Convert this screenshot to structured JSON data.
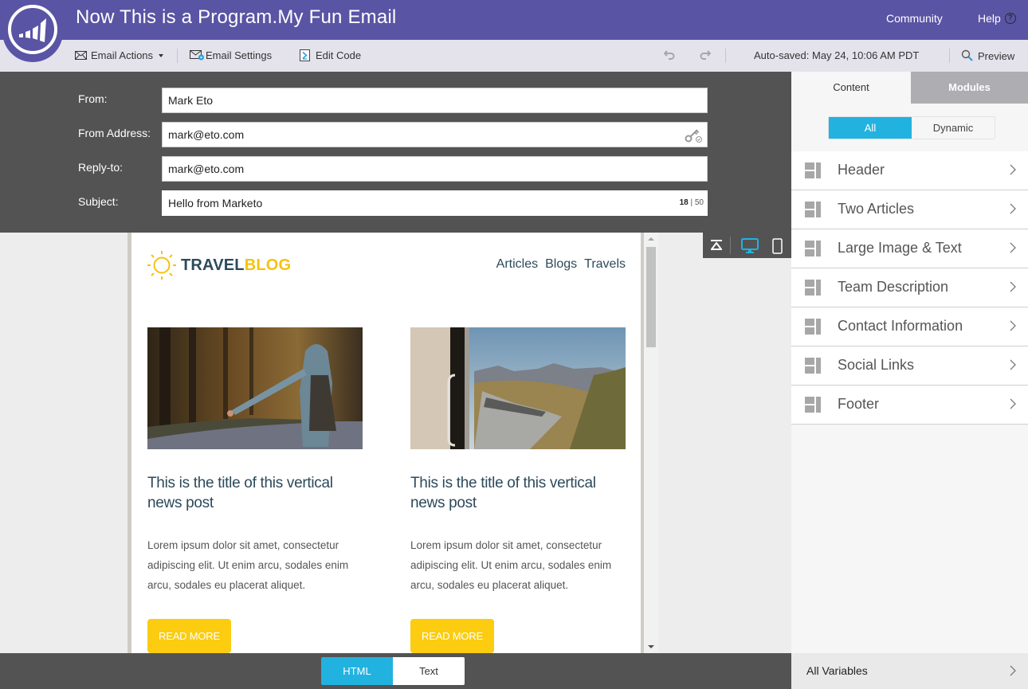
{
  "header": {
    "title": "Now This is a Program.My Fun Email",
    "links": {
      "community": "Community",
      "help": "Help",
      "help_icon_glyph": "?"
    },
    "brand_color": "#5a54a4"
  },
  "toolbar": {
    "email_actions": "Email Actions",
    "email_settings": "Email Settings",
    "edit_code": "Edit Code",
    "autosaved": "Auto-saved: May 24, 10:06 AM PDT",
    "preview": "Preview"
  },
  "fields": {
    "from": {
      "label": "From:",
      "value": "Mark Eto"
    },
    "from_address": {
      "label": "From Address:",
      "value": "mark@eto.com"
    },
    "reply_to": {
      "label": "Reply-to:",
      "value": "mark@eto.com"
    },
    "subject": {
      "label": "Subject:",
      "value": "Hello from Marketo",
      "count": "18",
      "max": "50"
    }
  },
  "email": {
    "brand_part1": "TRAVEL",
    "brand_part2": "BLOG",
    "nav": [
      "Articles",
      "Blogs",
      "Travels"
    ],
    "articles": [
      {
        "image_alt": "Hitchhiker in hoodie with backpack on forest road",
        "title": "This is the title of this vertical news post",
        "body": "Lorem ipsum dolor sit amet, consectetur adipiscing elit. Ut enim arcu, sodales enim arcu, sodales eu placerat aliquet.",
        "button": "READ MORE"
      },
      {
        "image_alt": "Train winding through mountain valley seen from window",
        "title": "This is the title of this vertical news post",
        "body": "Lorem ipsum dolor sit amet, consectetur adipiscing elit. Ut enim arcu, sodales enim arcu, sodales eu placerat aliquet.",
        "button": "READ MORE"
      }
    ],
    "accent_color": "#fbcc10"
  },
  "bottom": {
    "html_tab": "HTML",
    "text_tab": "Text",
    "active": "HTML"
  },
  "right_panel": {
    "tabs": {
      "content": "Content",
      "modules": "Modules"
    },
    "filter": {
      "all": "All",
      "dynamic": "Dynamic",
      "active": "All"
    },
    "modules": [
      {
        "label": "Header"
      },
      {
        "label": "Two Articles"
      },
      {
        "label": "Large Image & Text"
      },
      {
        "label": "Team Description"
      },
      {
        "label": "Contact Information"
      },
      {
        "label": "Social Links"
      },
      {
        "label": "Footer"
      }
    ],
    "all_variables": "All Variables",
    "accent_color": "#22b2e0"
  }
}
